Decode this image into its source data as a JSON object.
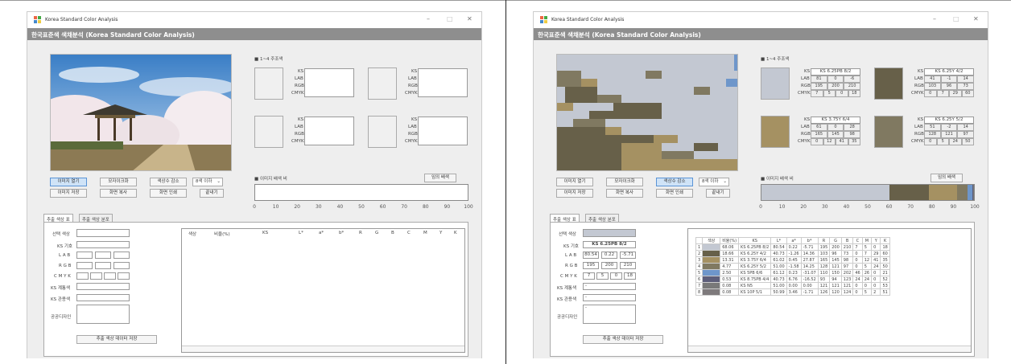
{
  "app": {
    "title": "Korea Standard Color Analysis",
    "header": "한국표준색 색채분석 (Korea Standard Color Analysis)",
    "minimize": "–",
    "maximize": "□",
    "close": "✕"
  },
  "section": {
    "main_colors": "■ 1~4 주조색",
    "ratio": "■ 이미지 배색 비",
    "random": "임의 배색"
  },
  "swatch_labels": {
    "ks": "KS",
    "lab": "LAB",
    "rgb": "RGB",
    "cmyk": "CMYK"
  },
  "buttons": {
    "open": "이미지 열기",
    "mosaic": "모자이크화",
    "reduce": "색상수 감소",
    "save_img": "이미지 저장",
    "copy": "화면 복사",
    "print": "화면 인쇄",
    "close": "끝내기",
    "save_data": "추출 색상 데이터 저장"
  },
  "dropdown": {
    "value": "8색 이하"
  },
  "tabs": [
    "추출 색상 표",
    "추출 색상 분포"
  ],
  "fields": {
    "sel": "선택 색상",
    "ks": "KS 기호",
    "lab": "L A B",
    "rgb": "R G B",
    "cmyk": "C M Y K",
    "ks_group": "KS 계통색",
    "ks_common": "KS 관용색",
    "public": "공공디자인"
  },
  "list_headers": [
    "색상",
    "비율(%)",
    "KS",
    "L*",
    "a*",
    "b*",
    "R",
    "G",
    "B",
    "C",
    "M",
    "Y",
    "K"
  ],
  "axis_ticks": [
    "0",
    "10",
    "20",
    "30",
    "40",
    "50",
    "60",
    "70",
    "80",
    "90",
    "100"
  ],
  "selected": {
    "ks": "KS 6.25PB 8/2",
    "lab": [
      "80.54",
      "0.22",
      "-5.71"
    ],
    "rgb": [
      "195",
      "200",
      "210"
    ],
    "cmyk": [
      "7",
      "5",
      "0",
      "18"
    ],
    "group": "-",
    "common": "-",
    "public": "-"
  },
  "main_colors": [
    {
      "ks": "KS 6.25PB 8/2",
      "lab": [
        "81",
        "0",
        "-6"
      ],
      "rgb": [
        "195",
        "200",
        "210"
      ],
      "cmyk": [
        "7",
        "5",
        "0",
        "18"
      ],
      "color": "#c3c8d2"
    },
    {
      "ks": "KS 6.25Y 4/2",
      "lab": [
        "41",
        "-1",
        "14"
      ],
      "rgb": [
        "103",
        "96",
        "73"
      ],
      "cmyk": [
        "0",
        "7",
        "29",
        "60"
      ],
      "color": "#676049"
    },
    {
      "ks": "KS 3.75Y 6/4",
      "lab": [
        "61",
        "0",
        "28"
      ],
      "rgb": [
        "165",
        "145",
        "98"
      ],
      "cmyk": [
        "0",
        "12",
        "41",
        "35"
      ],
      "color": "#a59162"
    },
    {
      "ks": "KS 6.25Y 5/2",
      "lab": [
        "51",
        "-2",
        "14"
      ],
      "rgb": [
        "128",
        "121",
        "97"
      ],
      "cmyk": [
        "0",
        "5",
        "24",
        "50"
      ],
      "color": "#807961"
    }
  ],
  "table": [
    {
      "n": "1",
      "color": "#c3c8d2",
      "pct": "68.06",
      "ks": "KS 6.25PB 8/2",
      "l": "80.54",
      "a": "0.22",
      "b": "-5.71",
      "r": "195",
      "g": "200",
      "bl": "210",
      "c": "7",
      "m": "5",
      "y": "0",
      "k": "18"
    },
    {
      "n": "2",
      "color": "#676049",
      "pct": "18.66",
      "ks": "KS 6.25Y 4/2",
      "l": "40.73",
      "a": "-1.26",
      "b": "14.36",
      "r": "103",
      "g": "96",
      "bl": "73",
      "c": "0",
      "m": "7",
      "y": "29",
      "k": "60"
    },
    {
      "n": "3",
      "color": "#a59162",
      "pct": "13.31",
      "ks": "KS 3.75Y 6/4",
      "l": "61.02",
      "a": "0.45",
      "b": "27.87",
      "r": "165",
      "g": "145",
      "bl": "98",
      "c": "0",
      "m": "12",
      "y": "41",
      "k": "35"
    },
    {
      "n": "4",
      "color": "#807961",
      "pct": "4.77",
      "ks": "KS 6.25Y 5/2",
      "l": "51.00",
      "a": "-1.58",
      "b": "14.25",
      "r": "128",
      "g": "121",
      "bl": "97",
      "c": "0",
      "m": "5",
      "y": "24",
      "k": "50"
    },
    {
      "n": "5",
      "color": "#6e96ca",
      "pct": "2.50",
      "ks": "KS 5PB 6/6",
      "l": "61.12",
      "a": "0.23",
      "b": "-31.07",
      "r": "110",
      "g": "150",
      "bl": "202",
      "c": "46",
      "m": "26",
      "y": "0",
      "k": "21"
    },
    {
      "n": "6",
      "color": "#5d5e7a",
      "pct": "0.53",
      "ks": "KS 8.75PB 4/4",
      "l": "40.73",
      "a": "6.76",
      "b": "-16.52",
      "r": "93",
      "g": "94",
      "bl": "123",
      "c": "24",
      "m": "24",
      "y": "0",
      "k": "52"
    },
    {
      "n": "7",
      "color": "#797979",
      "pct": "0.08",
      "ks": "KS N5",
      "l": "51.00",
      "a": "0.00",
      "b": "0.00",
      "r": "121",
      "g": "121",
      "bl": "121",
      "c": "0",
      "m": "0",
      "y": "0",
      "k": "53"
    },
    {
      "n": "8",
      "color": "#7e7a7c",
      "pct": "0.08",
      "ks": "KS 10P 5/1",
      "l": "50.99",
      "a": "3.46",
      "b": "-1.71",
      "r": "126",
      "g": "120",
      "bl": "124",
      "c": "0",
      "m": "5",
      "y": "2",
      "k": "51"
    }
  ],
  "bar_segments": [
    {
      "color": "#c3c8d2",
      "pct": 60.06
    },
    {
      "color": "#676049",
      "pct": 18.66
    },
    {
      "color": "#a59162",
      "pct": 13.31
    },
    {
      "color": "#807961",
      "pct": 4.77
    },
    {
      "color": "#6e96ca",
      "pct": 2.5
    },
    {
      "color": "#5d5e7a",
      "pct": 0.53
    },
    {
      "color": "#797979",
      "pct": 0.08
    },
    {
      "color": "#7e7a7c",
      "pct": 0.08
    }
  ]
}
